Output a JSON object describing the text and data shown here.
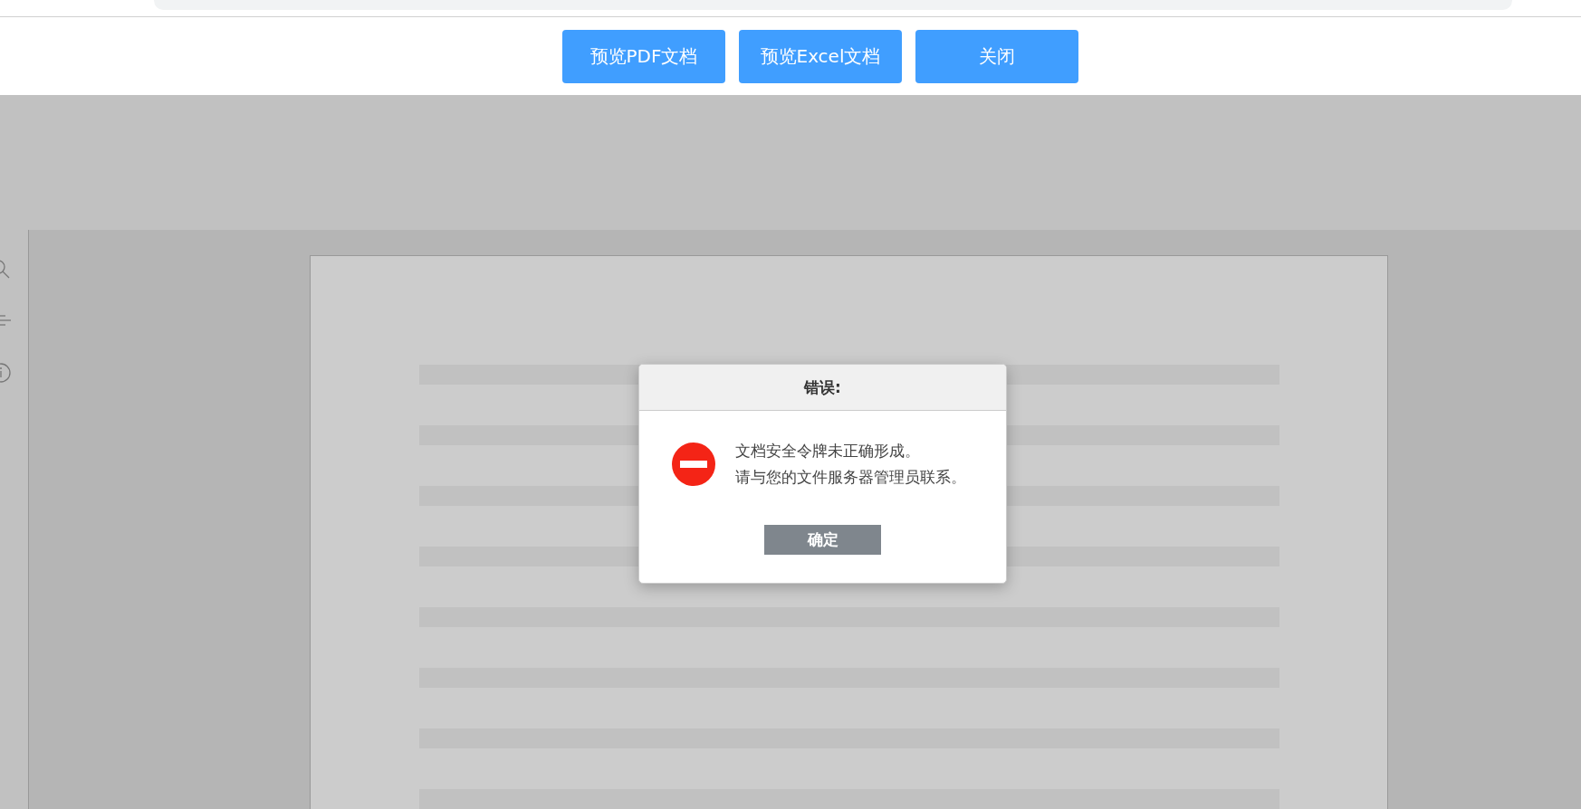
{
  "toolbar": {
    "buttons": [
      {
        "label": "预览PDF文档"
      },
      {
        "label": "预览Excel文档"
      },
      {
        "label": "关闭"
      }
    ]
  },
  "dialog": {
    "title": "错误:",
    "message": [
      "文档安全令牌未正确形成。",
      "请与您的文件服务器管理员联系。"
    ],
    "ok_button": "确定"
  }
}
